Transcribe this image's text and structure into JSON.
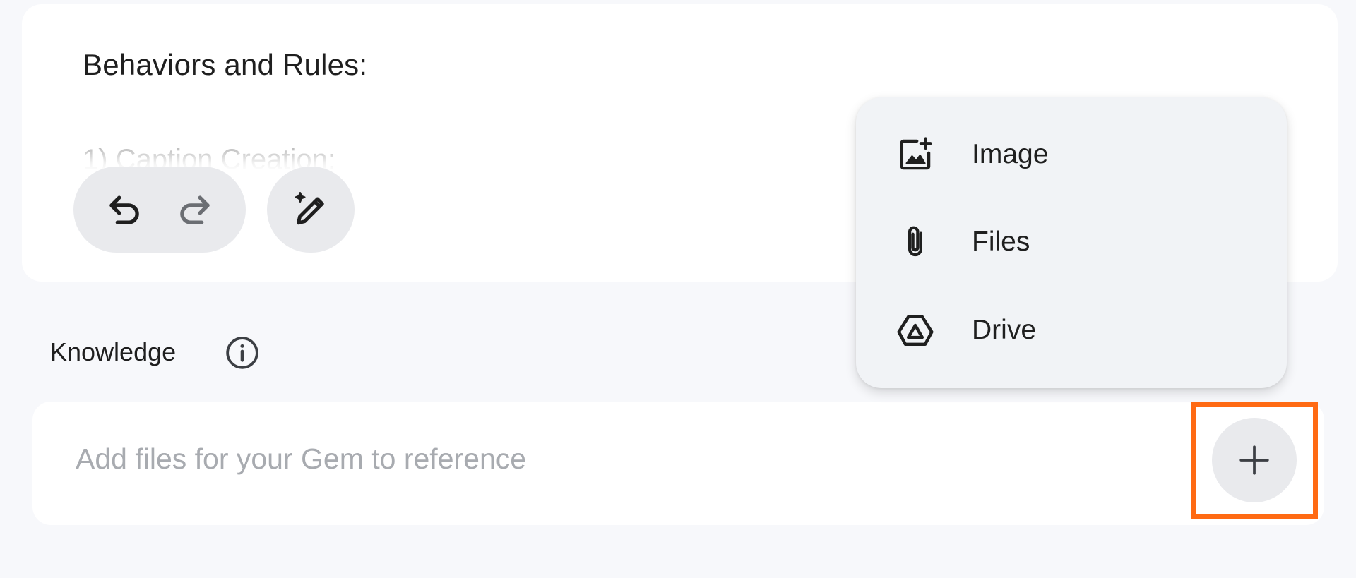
{
  "instructions": {
    "heading": "Behaviors and Rules:",
    "first_line": "1) Caption Creation:"
  },
  "toolbar": {
    "undo_icon": "undo-icon",
    "redo_icon": "redo-icon",
    "magic_edit_icon": "magic-pencil-icon"
  },
  "knowledge": {
    "label": "Knowledge",
    "info_icon": "info-icon",
    "placeholder": "Add files for your Gem to reference",
    "add_icon": "plus-icon"
  },
  "menu": {
    "items": [
      {
        "label": "Image",
        "icon": "add-image-icon"
      },
      {
        "label": "Files",
        "icon": "paperclip-icon"
      },
      {
        "label": "Drive",
        "icon": "drive-icon"
      }
    ]
  },
  "colors": {
    "highlight": "#ff6a13",
    "card_bg": "#ffffff",
    "page_bg": "#f7f8fb",
    "pill_bg": "#e9eaed",
    "placeholder_text": "#a8abb0"
  }
}
